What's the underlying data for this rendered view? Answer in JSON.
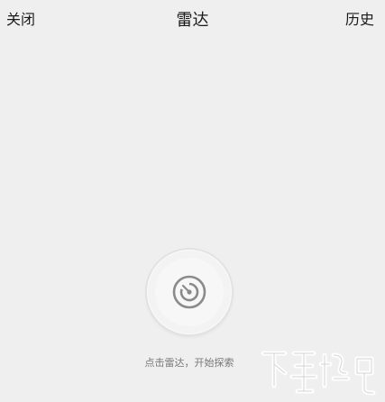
{
  "header": {
    "left_label": "关闭",
    "title": "雷达",
    "right_label": "历史"
  },
  "radar": {
    "icon": "radar-icon",
    "hint": "点击雷达，开始探索"
  },
  "watermark": {
    "icon": "site-logo-watermark"
  },
  "colors": {
    "background": "#efefef",
    "icon_gray": "#8a8a8a"
  }
}
